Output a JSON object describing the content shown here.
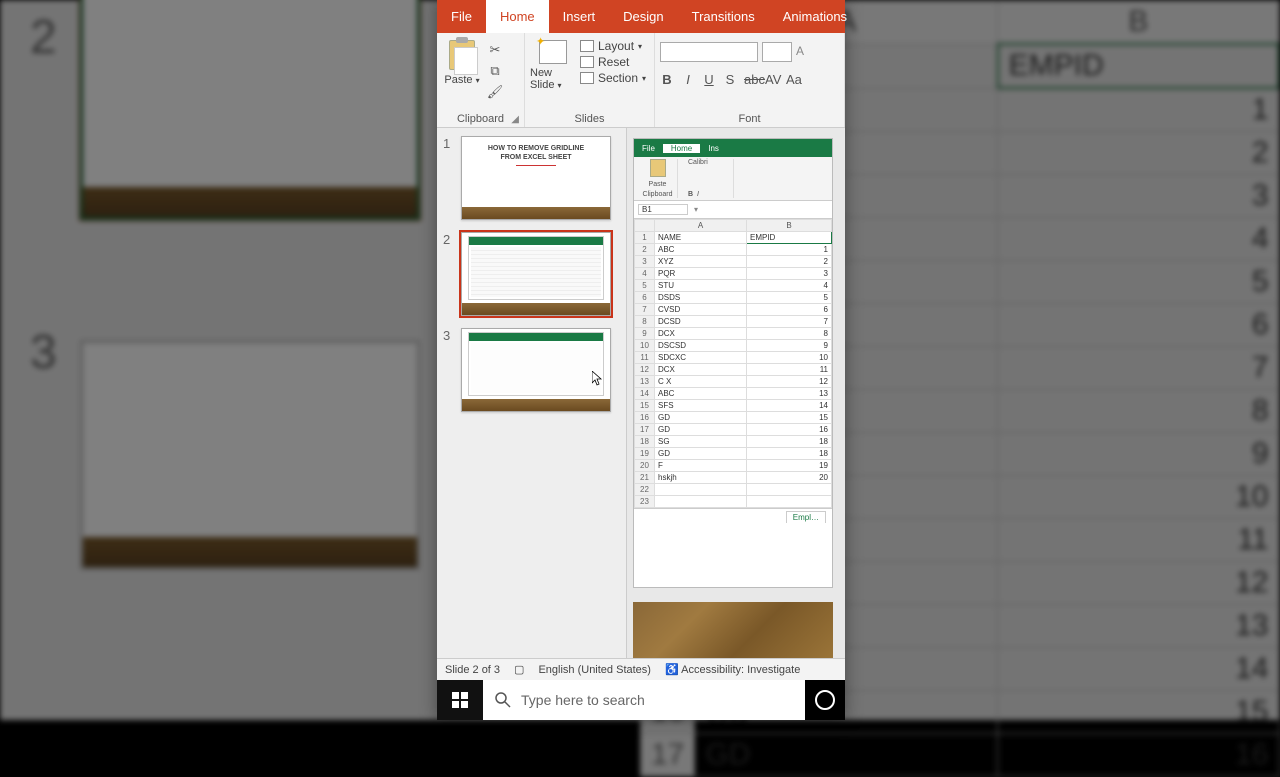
{
  "ribbon": {
    "tabs": {
      "file": "File",
      "home": "Home",
      "insert": "Insert",
      "design": "Design",
      "transitions": "Transitions",
      "animations": "Animations"
    },
    "clipboard": {
      "paste": "Paste",
      "label": "Clipboard"
    },
    "slides": {
      "newslide": "New Slide",
      "layout": "Layout",
      "reset": "Reset",
      "section": "Section",
      "label": "Slides"
    },
    "font": {
      "label": "Font",
      "size_placeholder": ""
    }
  },
  "thumbs": {
    "1": "1",
    "2": "2",
    "3": "3",
    "title_line1": "HOW TO REMOVE GRIDLINE",
    "title_line2": "FROM EXCEL SHEET"
  },
  "excel": {
    "tabs": {
      "file": "File",
      "home": "Home",
      "insert": "Ins"
    },
    "paste": "Paste",
    "clipboard": "Clipboard",
    "fontname": "Calibri",
    "namebox": "B1",
    "colA": "A",
    "colB": "B",
    "sheet_tab": "Empl…"
  },
  "chart_data": {
    "type": "table",
    "columns": [
      "NAME",
      "EMPID"
    ],
    "rows": [
      [
        "ABC",
        1
      ],
      [
        "XYZ",
        2
      ],
      [
        "PQR",
        3
      ],
      [
        "STU",
        4
      ],
      [
        "DSDS",
        5
      ],
      [
        "CVSD",
        6
      ],
      [
        "DCSD",
        7
      ],
      [
        "DCX",
        8
      ],
      [
        "DSCSD",
        9
      ],
      [
        "SDCXC",
        10
      ],
      [
        "DCX",
        11
      ],
      [
        "C X",
        12
      ],
      [
        "ABC",
        13
      ],
      [
        "SFS",
        14
      ],
      [
        "GD",
        15
      ],
      [
        "GD",
        16
      ],
      [
        "SG",
        18
      ],
      [
        "GD",
        18
      ],
      [
        "F",
        19
      ],
      [
        "hskjh",
        20
      ]
    ]
  },
  "status": {
    "slide": "Slide 2 of 3",
    "lang": "English (United States)",
    "a11y": "Accessibility: Investigate"
  },
  "taskbar": {
    "search_placeholder": "Type here to search"
  },
  "bg": {
    "colA": "A",
    "colB": "B",
    "header_name": "NAME",
    "header_emp": "EMPID"
  }
}
